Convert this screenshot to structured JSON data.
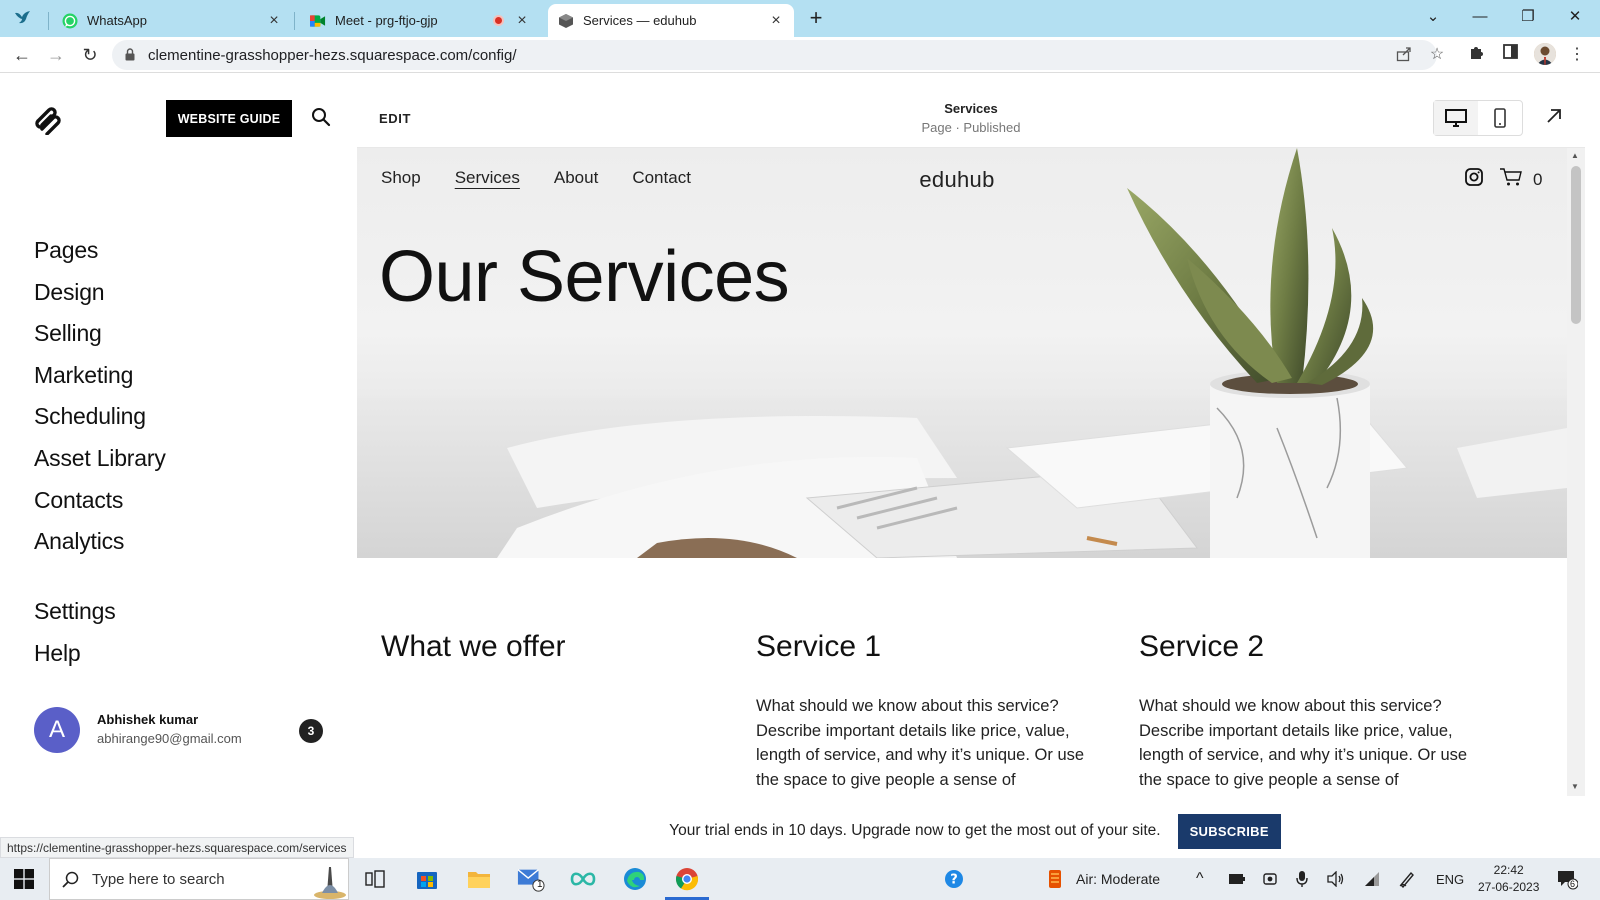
{
  "browser": {
    "tabs": [
      {
        "label": "WhatsApp",
        "close": "×"
      },
      {
        "label": "Meet - prg-ftjo-gjp",
        "close": "×"
      },
      {
        "label": "Services — eduhub",
        "close": "×"
      }
    ],
    "new_tab": "+",
    "window_controls": {
      "minimize": "—",
      "restore": "❐",
      "close": "✕",
      "tab_search": "⌄"
    },
    "url": "clementine-grasshopper-hezs.squarespace.com/config/",
    "status_url": "https://clementine-grasshopper-hezs.squarespace.com/services"
  },
  "sidebar": {
    "guide_button": "WEBSITE GUIDE",
    "nav": [
      "Pages",
      "Design",
      "Selling",
      "Marketing",
      "Scheduling",
      "Asset Library",
      "Contacts",
      "Analytics"
    ],
    "nav_secondary": [
      "Settings",
      "Help"
    ],
    "user": {
      "initial": "A",
      "name": "Abhishek kumar",
      "email": "abhirange90@gmail.com",
      "notifications": "3"
    }
  },
  "editor": {
    "edit_label": "EDIT",
    "page_title": "Services",
    "page_status": "Page · Published"
  },
  "site": {
    "nav": [
      "Shop",
      "Services",
      "About",
      "Contact"
    ],
    "logo": "eduhub",
    "cart_count": "0",
    "hero_title": "Our Services",
    "offer_title": "What we offer",
    "services": [
      {
        "title": "Service 1",
        "body": "What should we know about this service? Describe important details like price, value, length of service, and why it’s unique. Or use the space to give people a sense of"
      },
      {
        "title": "Service 2",
        "body": "What should we know about this service? Describe important details like price, value, length of service, and why it’s unique. Or use the space to give people a sense of"
      }
    ]
  },
  "trial": {
    "text": "Your trial ends in 10 days. Upgrade now to get the most out of your site.",
    "button": "SUBSCRIBE"
  },
  "taskbar": {
    "search_placeholder": "Type here to search",
    "mail_badge": "1",
    "weather": "Air: Moderate",
    "language": "ENG",
    "time": "22:42",
    "date": "27-06-2023",
    "notifications": "6"
  }
}
